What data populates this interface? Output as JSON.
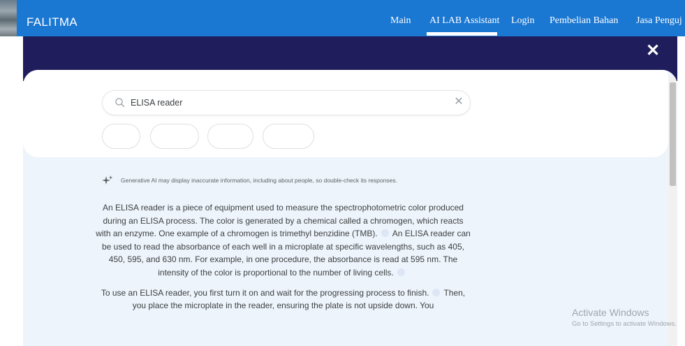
{
  "header": {
    "brand": "FALITMA",
    "nav": [
      "Main",
      "AI LAB Assistant",
      "Login",
      "Pembelian Bahan",
      "Jasa Penguj"
    ],
    "active_nav": "AI LAB Assistant"
  },
  "overlay": {
    "close_glyph": "✕"
  },
  "search": {
    "query": "ELISA reader",
    "clear_glyph": "✕",
    "chips": [
      "",
      "",
      "",
      ""
    ]
  },
  "disclaimer": "Generative AI may display inaccurate information, including about people, so double-check its responses.",
  "answer": {
    "p1_a": "An ELISA reader is a piece of equipment used to measure the spectrophotometric color produced during an ELISA process. The color is generated by a chemical called a chromogen, which reacts with an enzyme. One example of a chromogen is trimethyl benzidine (TMB).",
    "p1_b": "An ELISA reader can be used to read the absorbance of each well in a microplate at specific wavelengths, such as 405, 450, 595, and 630 nm. For example, in one procedure, the absorbance is read at 595 nm. The intensity of the color is proportional to the number of living cells.",
    "p2_a": "To use an ELISA reader, you first turn it on and wait for the progressing process to finish.",
    "p2_b": "Then, you place the microplate in the reader, ensuring the plate is not upside down. You"
  },
  "watermark": {
    "title": "Activate Windows",
    "subtitle": "Go to Settings to activate Windows."
  }
}
